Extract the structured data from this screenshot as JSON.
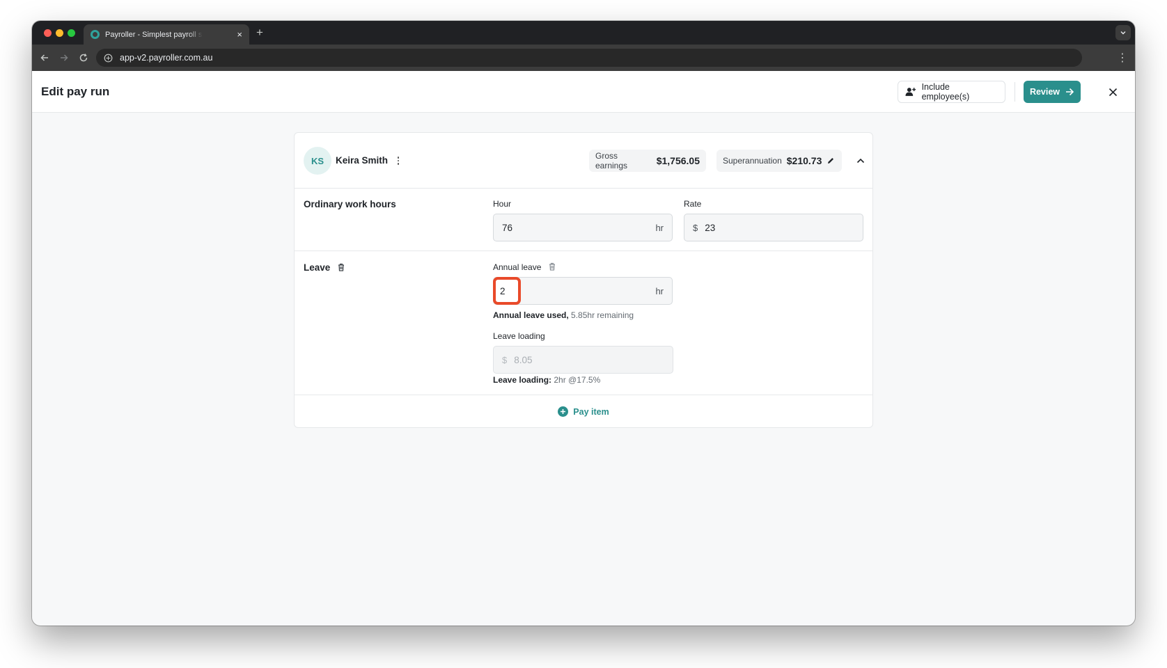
{
  "browser": {
    "tab_title": "Payroller - Simplest payroll software",
    "tab_close": "×",
    "new_tab": "+",
    "url": "app-v2.payroller.com.au"
  },
  "header": {
    "title": "Edit pay run",
    "include_label": "Include employee(s)",
    "review_label": "Review"
  },
  "employee": {
    "initials": "KS",
    "name": "Keira Smith",
    "gross_label": "Gross earnings",
    "gross_value": "$1,756.05",
    "super_label": "Superannuation",
    "super_value": "$210.73"
  },
  "ordinary": {
    "title": "Ordinary work hours",
    "hour_label": "Hour",
    "hour_value": "76",
    "hour_suffix": "hr",
    "rate_label": "Rate",
    "rate_prefix": "$",
    "rate_value": "23"
  },
  "leave": {
    "title": "Leave",
    "annual_label": "Annual leave",
    "annual_value": "2",
    "annual_suffix": "hr",
    "used_label": "Annual leave used,",
    "used_remaining": "5.85hr remaining",
    "loading_label": "Leave loading",
    "loading_prefix": "$",
    "loading_value": "8.05",
    "loading_caption_label": "Leave loading:",
    "loading_caption_value": "2hr @17.5%"
  },
  "footer": {
    "pay_item_label": "Pay item"
  },
  "colors": {
    "accent": "#2a8f8c",
    "highlight": "#e94a2a"
  }
}
